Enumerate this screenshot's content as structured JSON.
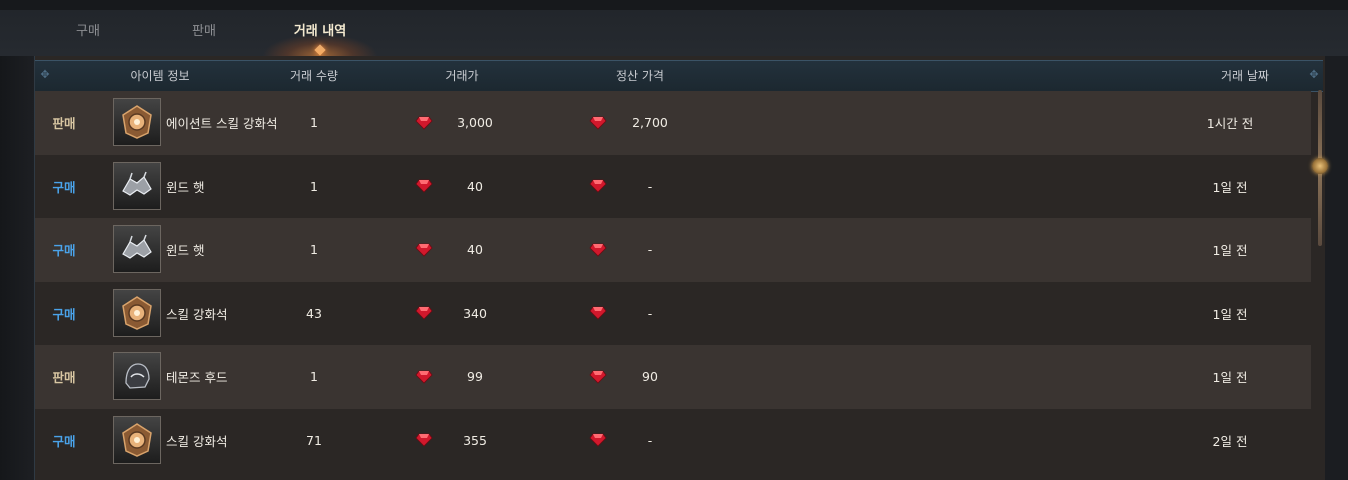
{
  "tabs": [
    {
      "label": "구매",
      "active": false
    },
    {
      "label": "판매",
      "active": false
    },
    {
      "label": "거래 내역",
      "active": true
    }
  ],
  "columns": {
    "item_info": "아이템 정보",
    "quantity": "거래 수량",
    "price": "거래가",
    "settlement": "정산 가격",
    "date": "거래 날짜"
  },
  "rows": [
    {
      "type": "판매",
      "type_kind": "sell",
      "icon": "skill-enhancement-stone-icon",
      "name": "에이션트 스킬 강화석",
      "quantity": "1",
      "price": "3,000",
      "settlement": "2,700",
      "date": "1시간 전"
    },
    {
      "type": "구매",
      "type_kind": "buy",
      "icon": "wind-hat-icon",
      "name": "윈드 햇",
      "quantity": "1",
      "price": "40",
      "settlement": "-",
      "date": "1일 전"
    },
    {
      "type": "구매",
      "type_kind": "buy",
      "icon": "wind-hat-icon",
      "name": "윈드 햇",
      "quantity": "1",
      "price": "40",
      "settlement": "-",
      "date": "1일 전"
    },
    {
      "type": "구매",
      "type_kind": "buy",
      "icon": "skill-enhancement-stone-icon",
      "name": "스킬 강화석",
      "quantity": "43",
      "price": "340",
      "settlement": "-",
      "date": "1일 전"
    },
    {
      "type": "판매",
      "type_kind": "sell",
      "icon": "hood-icon",
      "name": "테몬즈 후드",
      "quantity": "1",
      "price": "99",
      "settlement": "90",
      "date": "1일 전"
    },
    {
      "type": "구매",
      "type_kind": "buy",
      "icon": "skill-enhancement-stone-icon",
      "name": "스킬 강화석",
      "quantity": "71",
      "price": "355",
      "settlement": "-",
      "date": "2일 전"
    }
  ],
  "colors": {
    "sell": "#d8c6a2",
    "buy": "#4aa3ea",
    "gem": "#d1182c",
    "active_tab_glow": "#ff9b4a"
  },
  "currency_icon": "red-diamond-gem-icon"
}
